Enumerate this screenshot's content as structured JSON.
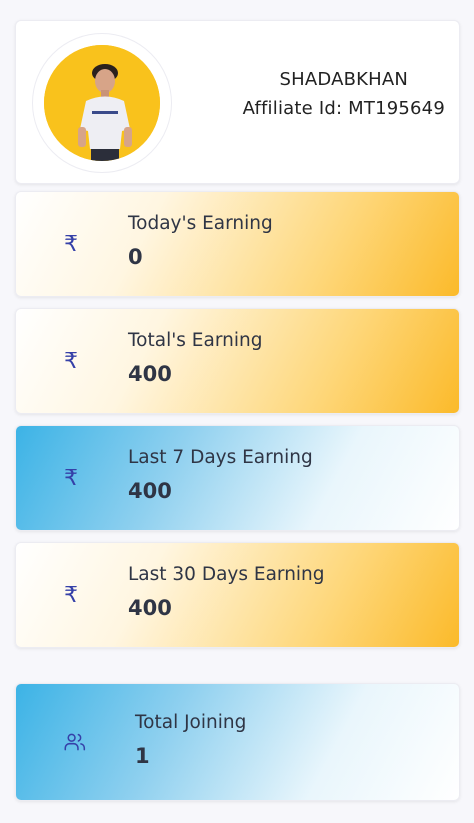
{
  "profile": {
    "name": "SHADABKHAN",
    "affiliate_id": "Affiliate Id: MT195649"
  },
  "stats": [
    {
      "label": "Today's Earning",
      "value": "0",
      "icon": "rupee-icon",
      "symbol": "₹"
    },
    {
      "label": "Total's Earning",
      "value": "400",
      "icon": "rupee-icon",
      "symbol": "₹"
    },
    {
      "label": "Last 7 Days Earning",
      "value": "400",
      "icon": "rupee-icon",
      "symbol": "₹"
    },
    {
      "label": "Last 30 Days Earning",
      "value": "400",
      "icon": "rupee-icon",
      "symbol": "₹"
    }
  ],
  "joining": {
    "label": "Total Joining",
    "value": "1",
    "icon": "users-icon"
  },
  "colors": {
    "accent_yellow": "#fbba2a",
    "accent_blue": "#3cb3e6",
    "icon_color": "#3540a8"
  }
}
